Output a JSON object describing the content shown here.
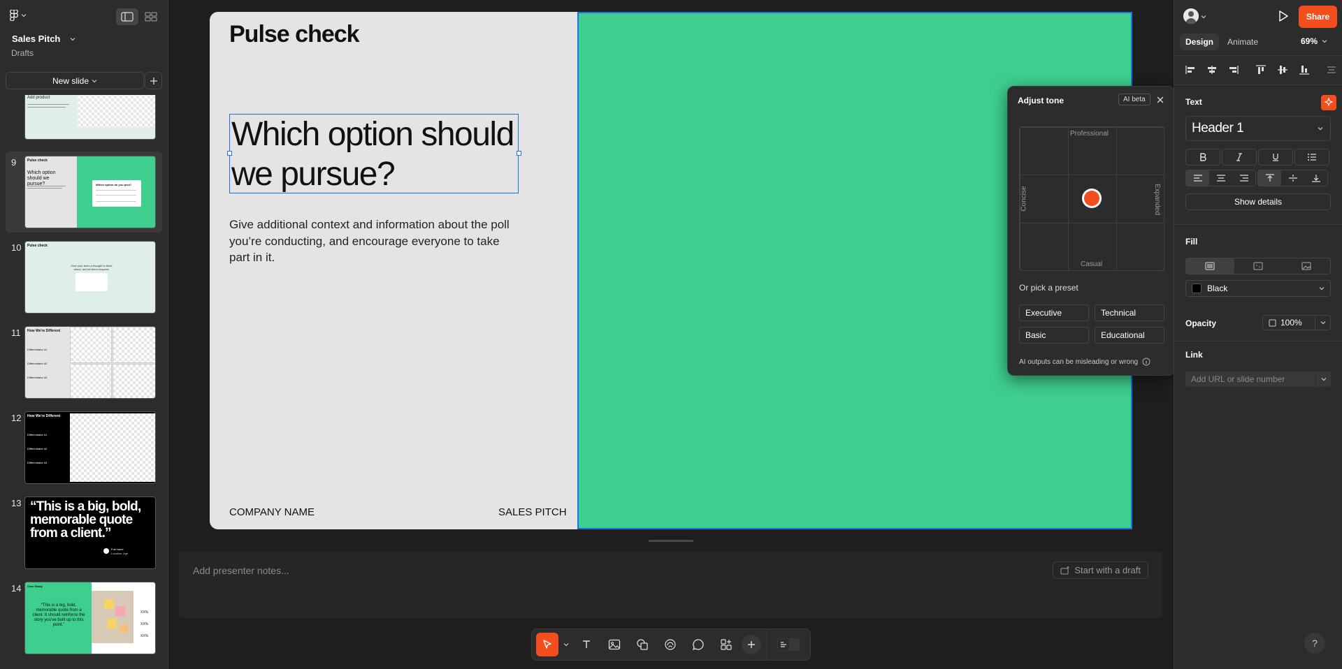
{
  "file": {
    "title": "Sales Pitch",
    "location": "Drafts"
  },
  "left": {
    "new_slide_label": "New slide"
  },
  "thumbs": {
    "t8_heading": "Add product",
    "t9_title": "Pulse check",
    "t9_heading": "Which option should we pursue?",
    "t9_card_title": "Which option do you pick?",
    "t10_title": "Pulse check",
    "t10_body": "Give your team a thought to think about, and let them respond.",
    "t11_title": "How We're Different",
    "t11_items": [
      "Differentiator #1",
      "Differentiator #2",
      "Differentiator #3"
    ],
    "t12_title": "How We're Different",
    "t12_items": [
      "Differentiator #1",
      "Differentiator #2",
      "Differentiator #3"
    ],
    "t13_quote": "“This is a big, bold, memorable quote from a client.”",
    "t13_name": "Full name",
    "t13_role": "Location, Age",
    "t14_title": "Case Study",
    "t14_quote": "“This is a big, bold, memorable quote from a client. It should reinforce the story you’ve built up to this point.”",
    "t14_stats": [
      "XX%",
      "XX%",
      "XX%"
    ]
  },
  "slides": [
    {
      "num": "9"
    },
    {
      "num": "10"
    },
    {
      "num": "11"
    },
    {
      "num": "12"
    },
    {
      "num": "13"
    },
    {
      "num": "14"
    }
  ],
  "slide": {
    "title": "Pulse check",
    "heading": "Which option should we pursue?",
    "body": "Give additional context and information about the poll you’re conducting, and encourage everyone to take part in it.",
    "company": "COMPANY NAME",
    "pitch": "SALES PITCH"
  },
  "notes": {
    "placeholder": "Add presenter notes...",
    "draft_label": "Start with a draft"
  },
  "tone": {
    "title": "Adjust tone",
    "badge": "AI beta",
    "top": "Professional",
    "bottom": "Casual",
    "left": "Concise",
    "right": "Expanded",
    "preset_label": "Or pick a preset",
    "presets": [
      "Executive",
      "Technical",
      "Basic",
      "Educational"
    ],
    "footer": "AI outputs can be misleading or wrong"
  },
  "right": {
    "share_label": "Share",
    "tabs": [
      "Design",
      "Animate"
    ],
    "zoom": "69%",
    "text_section": "Text",
    "text_style": "Header 1",
    "show_details": "Show details",
    "fill_section": "Fill",
    "fill_color_name": "Black",
    "opacity_section": "Opacity",
    "opacity_value": "100%",
    "link_section": "Link",
    "link_placeholder": "Add URL or slide number"
  },
  "colors": {
    "accent": "#f24e1e",
    "green": "#3ecf8e",
    "selection": "#1a73e8"
  }
}
